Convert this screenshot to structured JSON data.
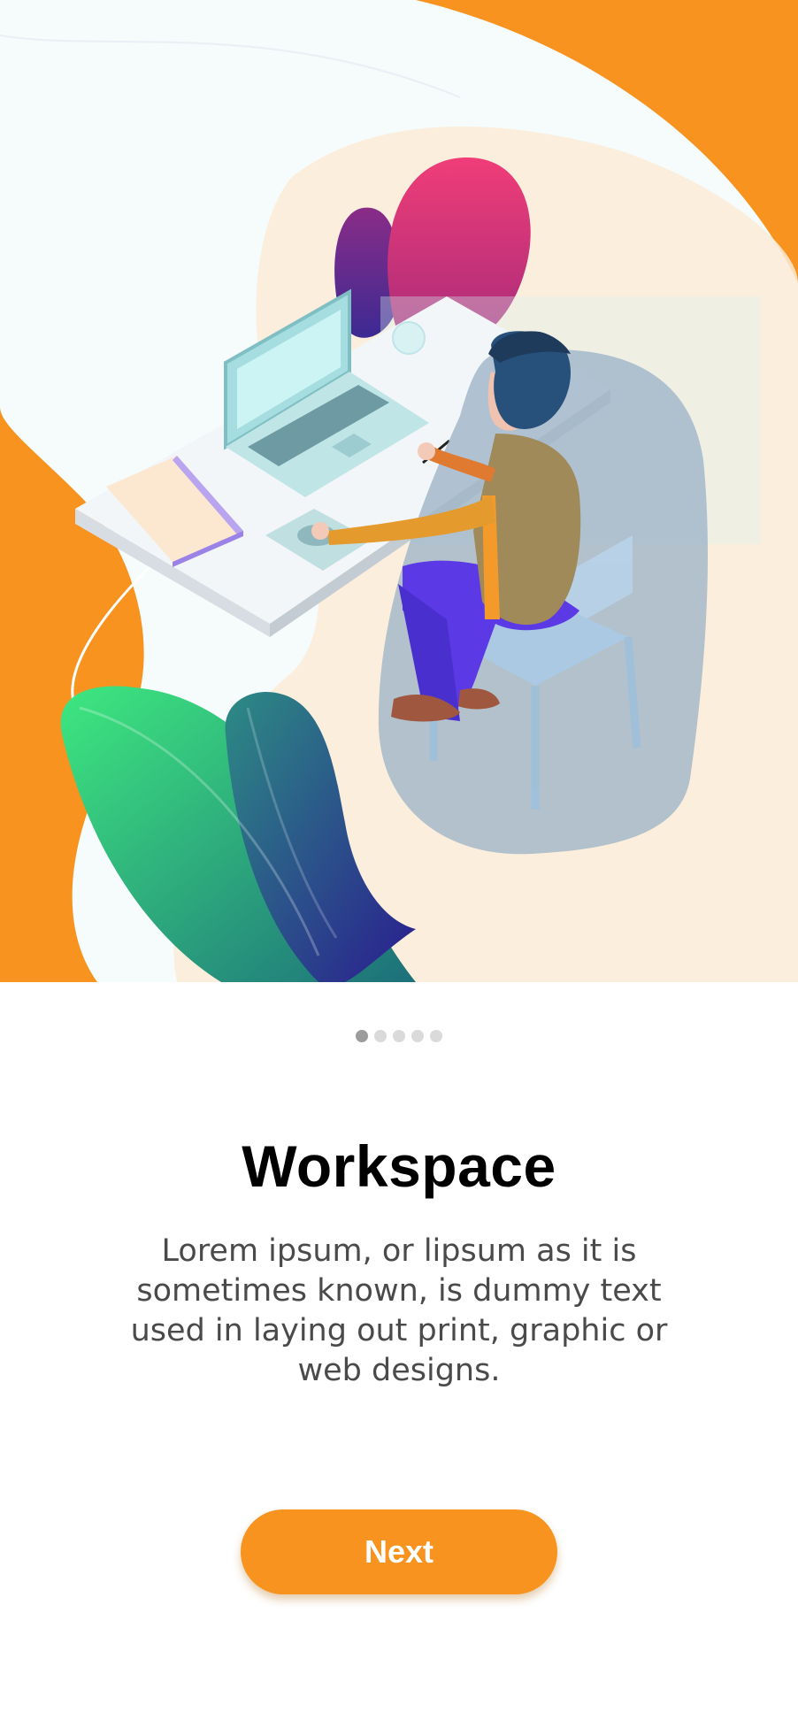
{
  "onboarding": {
    "illustration": "person-at-desk-with-laptop",
    "title": "Workspace",
    "description": "Lorem ipsum, or lipsum as it is sometimes known, is dummy text used in laying out print, graphic or web designs.",
    "next_label": "Next",
    "page_indicator": {
      "current": 1,
      "total": 5
    }
  },
  "colors": {
    "accent": "#f7931e",
    "dot_active": "#9c9c9c",
    "dot_inactive": "#dadada"
  }
}
